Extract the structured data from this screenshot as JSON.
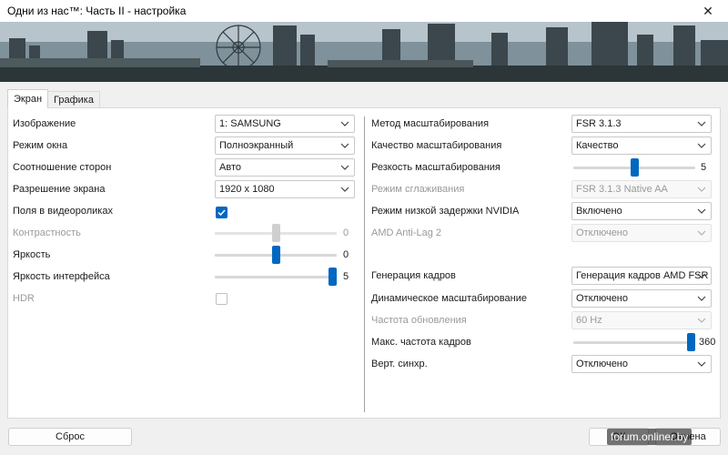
{
  "window": {
    "title": "Одни из нас™: Часть II - настройка",
    "close_glyph": "✕"
  },
  "tabs": [
    {
      "label": "Экран",
      "active": true
    },
    {
      "label": "Графика",
      "active": false
    }
  ],
  "left": {
    "image_label": "Изображение",
    "image_value": "1: SAMSUNG",
    "window_mode_label": "Режим окна",
    "window_mode_value": "Полноэкранный",
    "aspect_label": "Соотношение сторон",
    "aspect_value": "Авто",
    "resolution_label": "Разрешение экрана",
    "resolution_value": "1920 x 1080",
    "cutscene_label": "Поля в видеороликах",
    "cutscene_checked": true,
    "contrast_label": "Контрастность",
    "contrast_value": "0",
    "contrast_level": 0.5,
    "brightness_label": "Яркость",
    "brightness_value": "0",
    "brightness_level": 0.5,
    "ui_brightness_label": "Яркость интерфейса",
    "ui_brightness_value": "5",
    "ui_brightness_level": 1.0,
    "hdr_label": "HDR",
    "hdr_checked": false
  },
  "right": {
    "scaling_method_label": "Метод масштабирования",
    "scaling_method_value": "FSR 3.1.3",
    "scaling_quality_label": "Качество масштабирования",
    "scaling_quality_value": "Качество",
    "sharpness_label": "Резкость масштабирования",
    "sharpness_value": "5",
    "sharpness_level": 0.5,
    "aa_label": "Режим сглаживания",
    "aa_value": "FSR 3.1.3 Native AA",
    "reflex_label": "Режим низкой задержки NVIDIA",
    "reflex_value": "Включено",
    "antilag_label": "AMD Anti-Lag 2",
    "antilag_value": "Отключено",
    "framegen_label": "Генерация кадров",
    "framegen_value": "Генерация кадров AMD FSR",
    "dynres_label": "Динамическое масштабирование",
    "dynres_value": "Отключено",
    "refresh_label": "Частота обновления",
    "refresh_value": "60 Hz",
    "maxfps_label": "Макс. частота кадров",
    "maxfps_value": "360",
    "maxfps_level": 1.0,
    "vsync_label": "Верт. синхр.",
    "vsync_value": "Отключено"
  },
  "footer": {
    "reset_label": "Сброс",
    "ok_label": "ОК",
    "cancel_label": "Отмена"
  },
  "watermark": "forum.onliner.by",
  "colors": {
    "accent": "#0067c0"
  }
}
